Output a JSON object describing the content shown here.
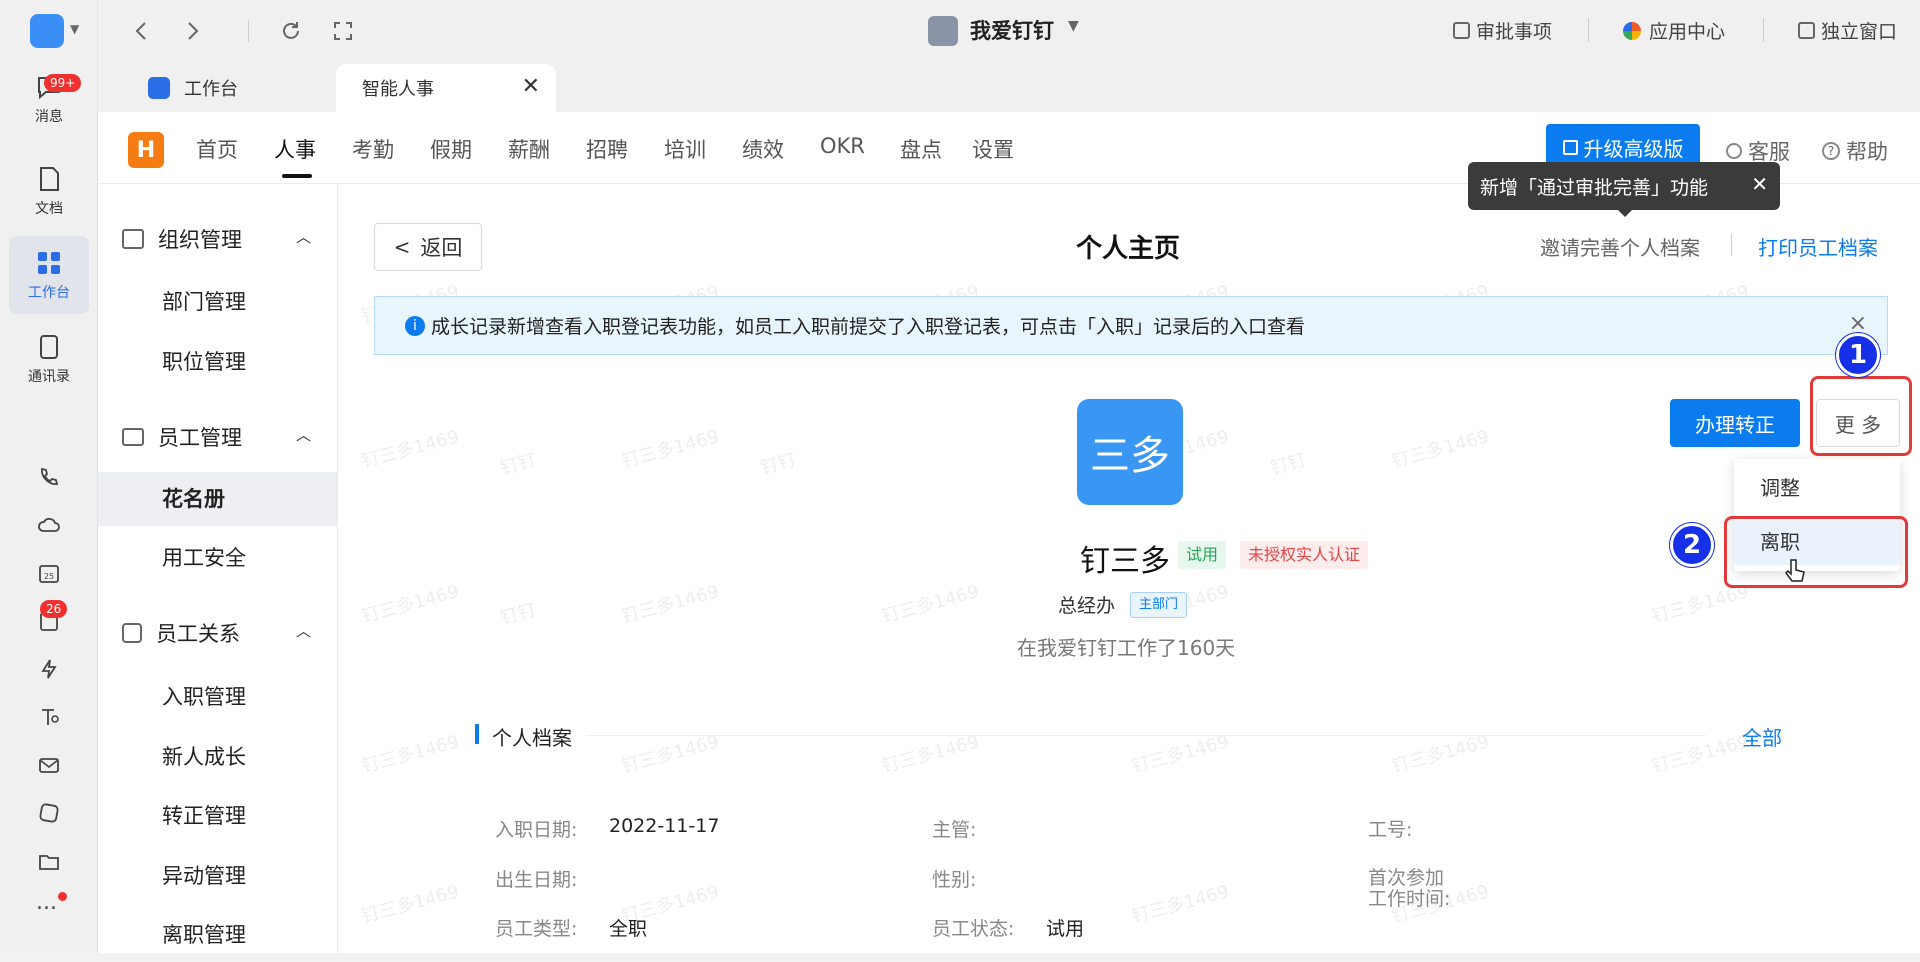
{
  "rail": {
    "messages": "消息",
    "messages_badge": "99+",
    "docs": "文档",
    "workbench": "工作台",
    "contacts": "通讯录",
    "todo_badge": "26",
    "more": "..."
  },
  "topbar": {
    "org_name": "我爱钉钉",
    "approvals": "审批事项",
    "app_center": "应用中心",
    "standalone": "独立窗口"
  },
  "tabs": [
    {
      "label": "工作台"
    },
    {
      "label": "智能人事"
    }
  ],
  "appnav": {
    "items": [
      "首页",
      "人事",
      "考勤",
      "假期",
      "薪酬",
      "招聘",
      "培训",
      "绩效",
      "OKR",
      "盘点",
      "设置"
    ],
    "upgrade": "升级高级版",
    "service": "客服",
    "help": "帮助"
  },
  "tooltip": {
    "text": "新增「通过审批完善」功能"
  },
  "sidebar": {
    "group1": "组织管理",
    "group1_items": [
      "部门管理",
      "职位管理"
    ],
    "group2": "员工管理",
    "group2_items": [
      "花名册",
      "用工安全"
    ],
    "group3": "员工关系",
    "group3_items": [
      "入职管理",
      "新人成长",
      "转正管理",
      "异动管理",
      "离职管理"
    ]
  },
  "page": {
    "back": "返回",
    "title": "个人主页",
    "invite": "邀请完善个人档案",
    "print": "打印员工档案",
    "notice": "成长记录新增查看入职登记表功能，如员工入职前提交了入职登记表，可点击「入职」记录后的入口查看",
    "notice_close": "×"
  },
  "profile": {
    "avatar_text": "三多",
    "name": "钉三多",
    "tag_trial": "试用",
    "tag_unverified": "未授权实人认证",
    "dept": "总经办",
    "dept_tag": "主部门",
    "tenure": "在我爱钉钉工作了160天"
  },
  "actions": {
    "regularize": "办理转正",
    "more": "更 多",
    "menu": [
      "调整",
      "离职"
    ]
  },
  "annotations": {
    "step1": "1",
    "step2": "2"
  },
  "section": {
    "title": "个人档案",
    "all": "全部"
  },
  "fields": {
    "hire_date_label": "入职日期:",
    "hire_date": "2022-11-17",
    "manager_label": "主管:",
    "emp_no_label": "工号:",
    "birth_label": "出生日期:",
    "gender_label": "性别:",
    "first_work_label_1": "首次参加",
    "first_work_label_2": "工作时间:",
    "type_label": "员工类型:",
    "type": "全职",
    "status_label": "员工状态:",
    "status": "试用"
  },
  "watermark": [
    "钉三多1469",
    "钉钉"
  ]
}
